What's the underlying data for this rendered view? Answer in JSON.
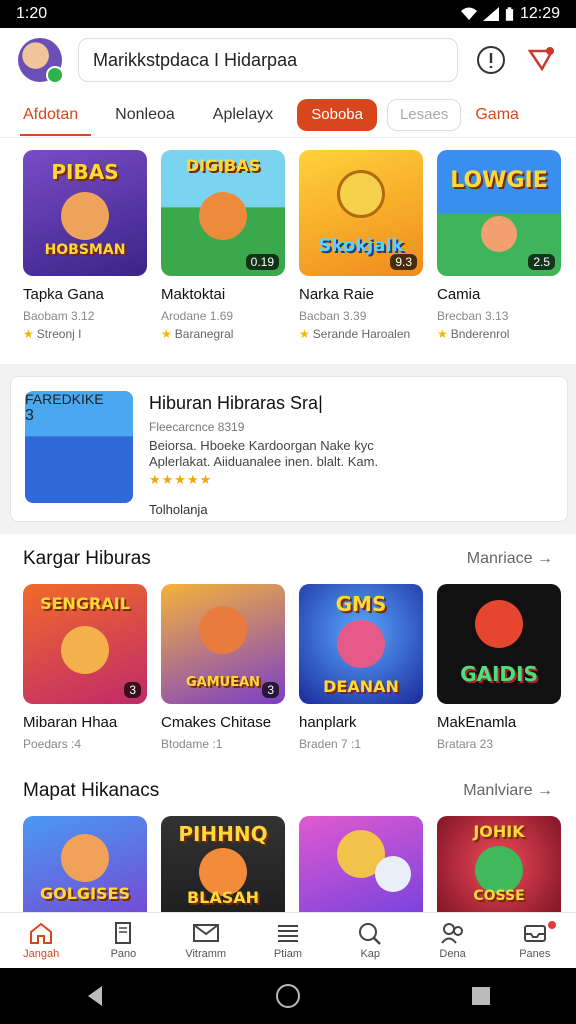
{
  "status": {
    "time": "1:20",
    "clock": "12:29"
  },
  "search": {
    "value": "Marikkstpdaca I Hidarpaa"
  },
  "tabs": [
    {
      "label": "Afdotan"
    },
    {
      "label": "Nonleoa"
    },
    {
      "label": "Aplelayx"
    },
    {
      "label": "Soboba"
    },
    {
      "label": "Lesaes"
    },
    {
      "label": "Gama"
    }
  ],
  "top_row": [
    {
      "cap": "PIBAS",
      "cap2": "HOBSMAN",
      "badge": "",
      "name": "Tapka Gana",
      "sub": "Baobam 3.12",
      "meta": "Streonj I",
      "bg": "#6a3fb5",
      "face": "#f0a35a"
    },
    {
      "cap": "DIGIBAS",
      "cap2": "",
      "badge": "0.19",
      "name": "Maktoktai",
      "sub": "Arodane 1.69",
      "meta": "Baranegral",
      "bg": "#3aa84b",
      "face": "#ee8a3c"
    },
    {
      "cap": "Skokjalk",
      "cap2": "",
      "badge": "9.3",
      "name": "Narka Raie",
      "sub": "Bacban 3.39",
      "meta": "Serande Haroalen",
      "bg": "#f5b623",
      "face": "#f5d04a"
    },
    {
      "cap": "LOWGIE",
      "cap2": "",
      "badge": "2.5",
      "name": "Camia",
      "sub": "Brecban 3.13",
      "meta": "Bnderenrol",
      "bg": "#2f78d6",
      "face": "#f3a070"
    }
  ],
  "featured": {
    "thumb_cap": "FAREDKIKE",
    "badge": "3",
    "title": "Hiburan Hibraras Sra|",
    "sub": "Fleecarcnce 8319",
    "desc": "Beiorsa. Hboeke Kardoorgan Nake kyc Aplerlakat. Aiiduanalee inen. blalt. Kam.",
    "stars": "★★★★★",
    "more": "Tolholanja"
  },
  "section1": {
    "title": "Kargar Hiburas",
    "link": "Manriace",
    "items": [
      {
        "cap": "SENGRAIL",
        "badge": "3",
        "name": "Mibaran Hhaa",
        "sub": "Poedars :4",
        "bg": "#e8502a",
        "face": "#f4b04a"
      },
      {
        "cap": "GAMUEAN",
        "badge": "3",
        "name": "Cmakes Chitase",
        "sub": "Btodame :1",
        "bg": "#f0a22c",
        "face": "#e87b3e"
      },
      {
        "cap": "GMS",
        "cap2": "DEANAN",
        "badge": "",
        "name": "hanplark",
        "sub": "Braden 7 :1",
        "bg": "#2b3fc9",
        "face": "#e65a8a"
      },
      {
        "cap": "GAIDIS",
        "badge": "",
        "name": "MakEnamla",
        "sub": "Bratara 23",
        "bg": "#111111",
        "face": "#e6462e"
      }
    ]
  },
  "section2": {
    "title": "Mapat Hikanacs",
    "link": "Manlviare",
    "items": [
      {
        "cap": "GOLGISES",
        "bg": "#2f7fe0",
        "face": "#f1a25a"
      },
      {
        "cap": "PIHHNQ",
        "cap2": "BLASAH",
        "bg": "#2a2a2a",
        "face": "#f28b3a"
      },
      {
        "cap": "",
        "bg": "#c04bd8",
        "face": "#f3c24a"
      },
      {
        "cap": "JOHIK",
        "cap2": "COSSE",
        "bg": "#b51a2e",
        "face": "#3fb95a"
      }
    ]
  },
  "bottom_nav": [
    {
      "label": "Jangah",
      "icon": "home-icon"
    },
    {
      "label": "Pano",
      "icon": "document-icon"
    },
    {
      "label": "Vitramm",
      "icon": "mail-icon"
    },
    {
      "label": "Ptiam",
      "icon": "list-icon"
    },
    {
      "label": "Kap",
      "icon": "search-icon"
    },
    {
      "label": "Dena",
      "icon": "people-icon"
    },
    {
      "label": "Panes",
      "icon": "inbox-icon"
    }
  ],
  "colors": {
    "accent": "#d9461b"
  }
}
